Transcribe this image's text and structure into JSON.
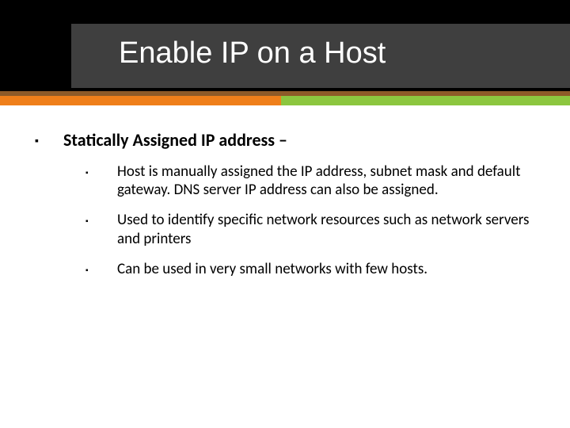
{
  "title": "Enable IP on a Host",
  "main": {
    "heading": "Statically Assigned IP address –",
    "items": [
      "Host is manually assigned the IP address, subnet mask and default gateway. DNS server IP address can also  be assigned.",
      "Used to identify specific network resources such as network servers and printers",
      "Can be used in very small networks with few hosts."
    ]
  }
}
